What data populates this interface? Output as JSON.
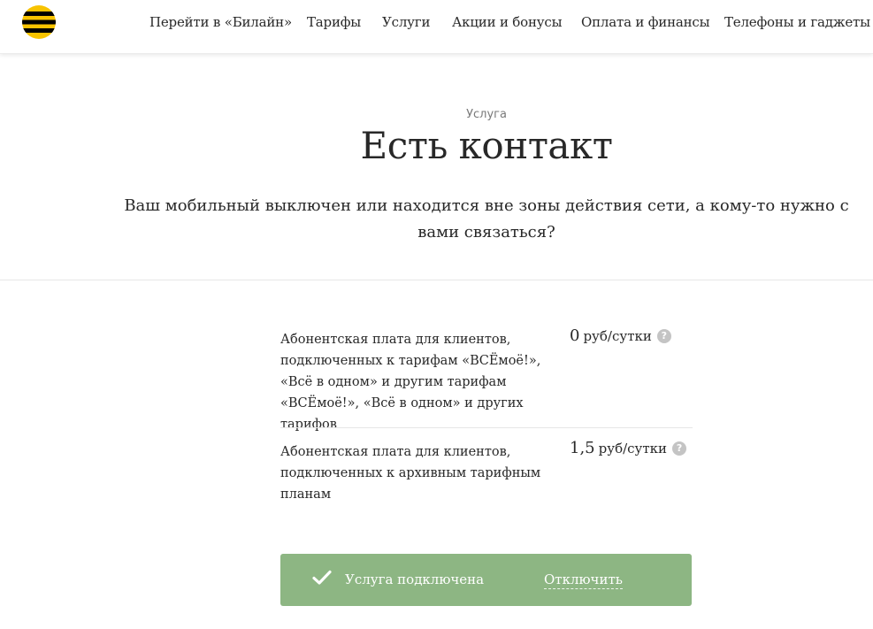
{
  "brand": {
    "name": "Билайн",
    "colors": {
      "yellow": "#f8c300",
      "black": "#000000"
    },
    "logo_icon": "beeline-striped-ball-icon"
  },
  "nav": {
    "items": [
      {
        "label": "Перейти в «Билайн»"
      },
      {
        "label": "Тарифы"
      },
      {
        "label": "Услуги"
      },
      {
        "label": "Акции и бонусы"
      },
      {
        "label": "Оплата и финансы"
      },
      {
        "label": "Телефоны и гаджеты"
      }
    ]
  },
  "hero": {
    "eyebrow": "Услуга",
    "title": "Есть контакт",
    "description": "Ваш мобильный выключен или находится вне зоны действия сети, а кому-то нужно с вами связаться?"
  },
  "fees": [
    {
      "label": "Абонентская плата для клиентов, подключенных к тарифам «ВСЁмоё!», «Всё в одном» и другим тарифам «ВСЁмоё!», «Всё в одном» и других тарифов",
      "amount": "0",
      "unit": "руб/сутки",
      "help_icon": "question-circle-icon"
    },
    {
      "label": "Абонентская плата для клиентов, подключенных к архивным тарифным планам",
      "amount": "1,5",
      "unit": "руб/сутки",
      "help_icon": "question-circle-icon"
    }
  ],
  "status": {
    "connected_label": "Услуга подключена",
    "disconnect_label": "Отключить",
    "check_icon": "checkmark-icon",
    "background_color": "#8db683"
  }
}
